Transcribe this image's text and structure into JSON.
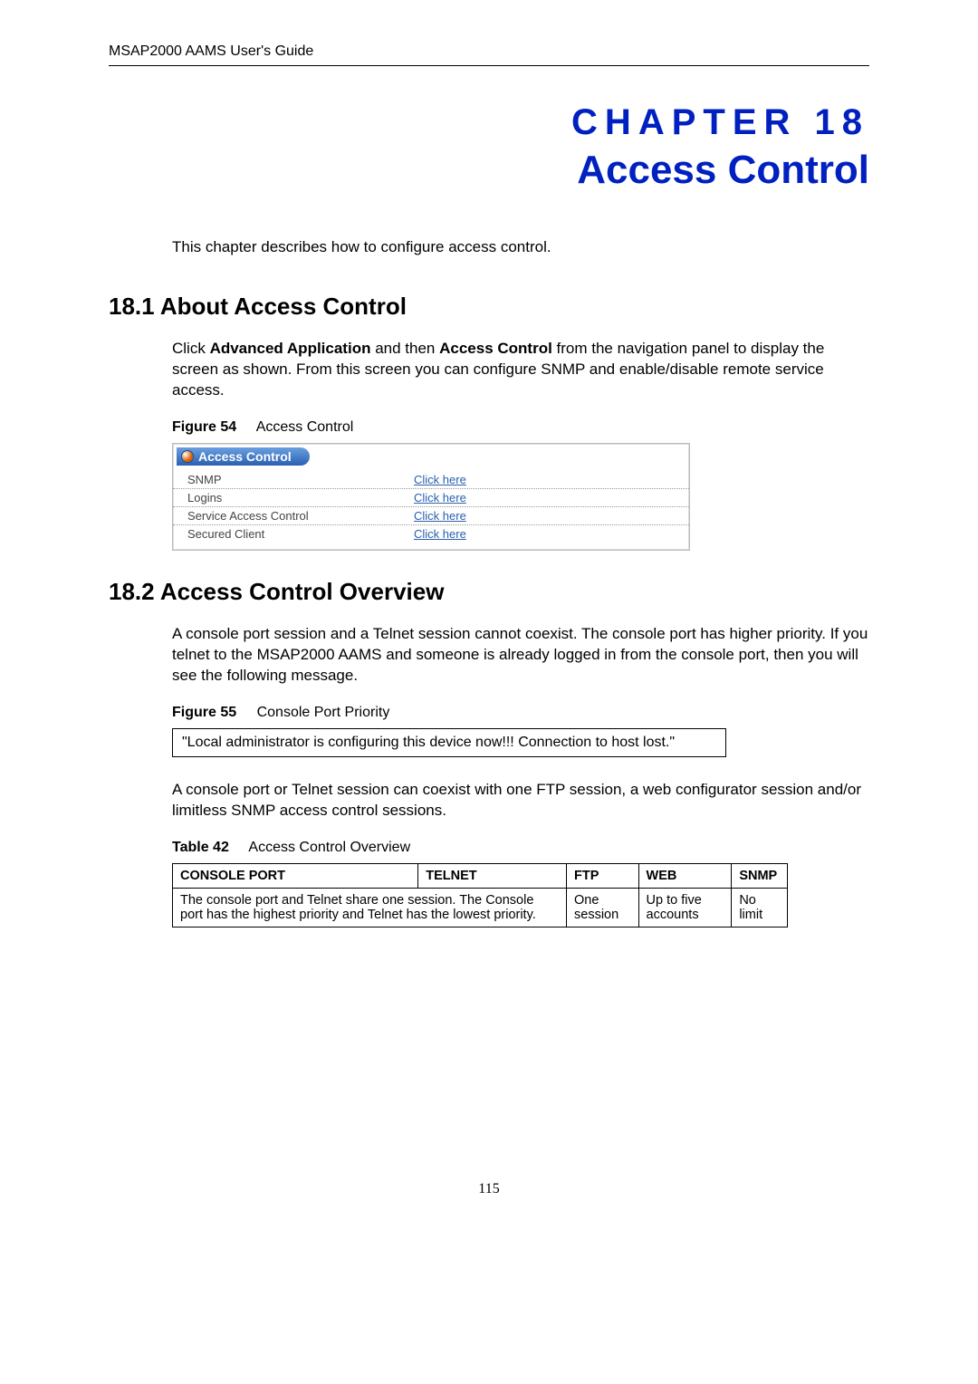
{
  "header": "MSAP2000 AAMS User's Guide",
  "chapter_label": "CHAPTER 18",
  "chapter_title": "Access Control",
  "intro": "This chapter describes how to configure access control.",
  "sec1": {
    "heading": "18.1  About Access Control",
    "para_parts": {
      "p1": "Click ",
      "b1": "Advanced Application",
      "p2": " and then ",
      "b2": "Access Control",
      "p3": " from the navigation panel to display the screen as shown. From this screen you can configure SNMP and enable/disable remote service access."
    },
    "fig54": {
      "label": "Figure 54",
      "caption": "Access Control",
      "panel_title": "Access Control",
      "rows": [
        {
          "label": "SNMP",
          "link": "Click here"
        },
        {
          "label": "Logins",
          "link": "Click here"
        },
        {
          "label": "Service Access Control",
          "link": "Click here"
        },
        {
          "label": "Secured Client",
          "link": "Click here"
        }
      ]
    }
  },
  "sec2": {
    "heading": "18.2  Access Control Overview",
    "para1": "A console port session and a Telnet session cannot coexist. The console port has higher priority. If you telnet to the MSAP2000 AAMS and someone is already logged in from the console port, then you will see the following message.",
    "fig55": {
      "label": "Figure 55",
      "caption": "Console Port Priority",
      "message": "\"Local administrator is configuring this device now!!! Connection to host lost.\""
    },
    "para2": "A console port or Telnet session can coexist with one FTP session, a web configurator session and/or limitless SNMP access control sessions.",
    "table42": {
      "label": "Table 42",
      "caption": "Access Control Overview",
      "headers": [
        "CONSOLE PORT",
        "TELNET",
        "FTP",
        "WEB",
        "SNMP"
      ],
      "row": {
        "console_telnet": "The console port and Telnet share one session. The Console port has the highest priority and Telnet has the lowest priority.",
        "ftp": "One session",
        "web": "Up to five accounts",
        "snmp": "No limit"
      }
    }
  },
  "page_number": "115"
}
